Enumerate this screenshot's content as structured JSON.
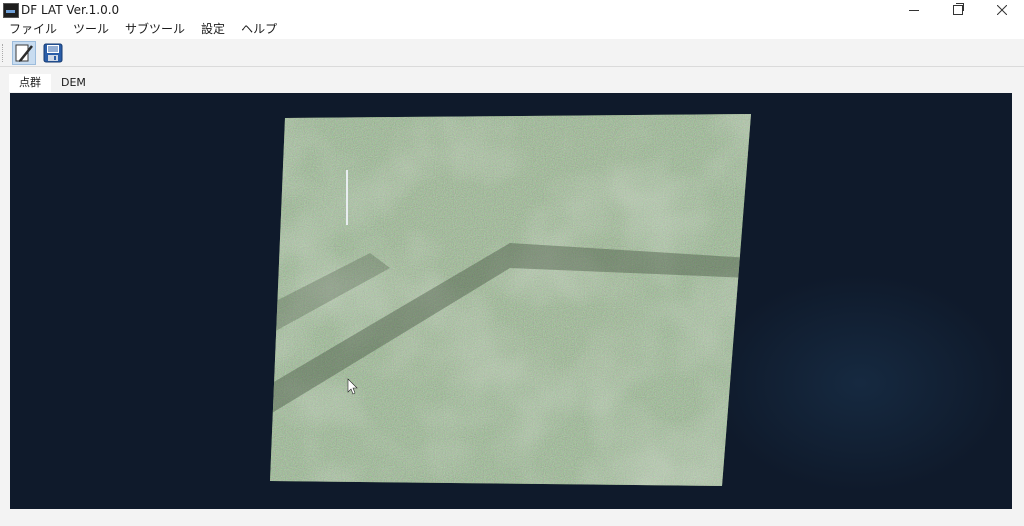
{
  "window": {
    "title": "DF LAT Ver.1.0.0"
  },
  "menu": {
    "items": [
      "ファイル",
      "ツール",
      "サブツール",
      "設定",
      "ヘルプ"
    ]
  },
  "toolbar": {
    "buttons": [
      {
        "icon": "edit-pencil-icon",
        "state": "pressed"
      },
      {
        "icon": "save-disk-icon"
      }
    ]
  },
  "tabs": {
    "items": [
      "点群",
      "DEM"
    ],
    "active": "点群"
  },
  "viewer": {
    "background": "#0f1a2b",
    "content": "point-cloud",
    "point_color": "#6f8a56"
  }
}
